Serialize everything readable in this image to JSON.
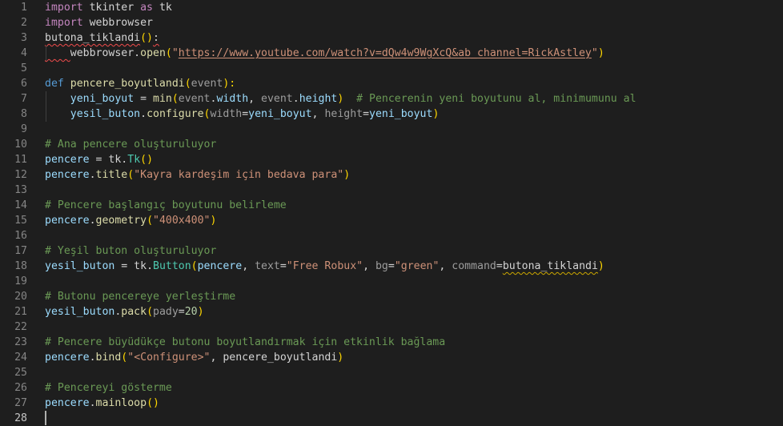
{
  "editor": {
    "language": "python",
    "colors": {
      "background": "#1e1e1e",
      "keyword": "#c586c0",
      "storage": "#569cd6",
      "function": "#dcdcaa",
      "variable": "#9cdcfe",
      "class": "#4ec9b0",
      "string": "#ce9178",
      "number": "#b5cea8",
      "comment": "#6a9955",
      "default": "#d4d4d4",
      "param_dim": "#9d9d9d",
      "bracket_gold": "#ffd700",
      "bracket_violet": "#da70d6",
      "error_squiggle": "#f14c4c",
      "warning_squiggle": "#cca700"
    },
    "lines": [
      {
        "n": "1",
        "tokens": [
          {
            "t": "import",
            "c": "keyword"
          },
          {
            "t": " tkinter ",
            "c": "default"
          },
          {
            "t": "as",
            "c": "keyword"
          },
          {
            "t": " tk",
            "c": "default"
          }
        ]
      },
      {
        "n": "2",
        "tokens": [
          {
            "t": "import",
            "c": "keyword"
          },
          {
            "t": " webbrowser",
            "c": "default"
          }
        ]
      },
      {
        "n": "3",
        "tokens": [
          {
            "t": "butona_tiklandi",
            "c": "default",
            "u": "err"
          },
          {
            "t": "()",
            "c": "bracket_gold"
          },
          {
            "t": ":",
            "c": "default",
            "u": "err"
          }
        ]
      },
      {
        "n": "4",
        "tokens": [
          {
            "t": "    ",
            "c": "default",
            "u": "err"
          },
          {
            "t": "webbrowser",
            "c": "default"
          },
          {
            "t": ".",
            "c": "default"
          },
          {
            "t": "open",
            "c": "function"
          },
          {
            "t": "(",
            "c": "bracket_gold"
          },
          {
            "t": "\"",
            "c": "string"
          },
          {
            "t": "https://www.youtube.com/watch?v=dQw4w9WgXcQ&ab_channel=RickAstley",
            "c": "string",
            "u": "url"
          },
          {
            "t": "\"",
            "c": "string"
          },
          {
            "t": ")",
            "c": "bracket_gold"
          }
        ]
      },
      {
        "n": "5",
        "tokens": []
      },
      {
        "n": "6",
        "tokens": [
          {
            "t": "def",
            "c": "storage"
          },
          {
            "t": " ",
            "c": "default"
          },
          {
            "t": "pencere_boyutlandi",
            "c": "function"
          },
          {
            "t": "(",
            "c": "bracket_gold"
          },
          {
            "t": "event",
            "c": "param_dim"
          },
          {
            "t": "):",
            "c": "bracket_gold"
          }
        ]
      },
      {
        "n": "7",
        "tokens": [
          {
            "t": "    ",
            "c": "default"
          },
          {
            "t": "yeni_boyut",
            "c": "variable"
          },
          {
            "t": " = ",
            "c": "default"
          },
          {
            "t": "min",
            "c": "function"
          },
          {
            "t": "(",
            "c": "bracket_gold"
          },
          {
            "t": "event",
            "c": "param_dim"
          },
          {
            "t": ".",
            "c": "default"
          },
          {
            "t": "width",
            "c": "variable"
          },
          {
            "t": ", ",
            "c": "default"
          },
          {
            "t": "event",
            "c": "param_dim"
          },
          {
            "t": ".",
            "c": "default"
          },
          {
            "t": "height",
            "c": "variable"
          },
          {
            "t": ")",
            "c": "bracket_gold"
          },
          {
            "t": "  ",
            "c": "default"
          },
          {
            "t": "# Pencerenin yeni boyutunu al, minimumunu al",
            "c": "comment"
          }
        ]
      },
      {
        "n": "8",
        "tokens": [
          {
            "t": "    ",
            "c": "default"
          },
          {
            "t": "yesil_buton",
            "c": "variable"
          },
          {
            "t": ".",
            "c": "default"
          },
          {
            "t": "configure",
            "c": "function"
          },
          {
            "t": "(",
            "c": "bracket_gold"
          },
          {
            "t": "width",
            "c": "param_dim"
          },
          {
            "t": "=",
            "c": "default"
          },
          {
            "t": "yeni_boyut",
            "c": "variable"
          },
          {
            "t": ", ",
            "c": "default"
          },
          {
            "t": "height",
            "c": "param_dim"
          },
          {
            "t": "=",
            "c": "default"
          },
          {
            "t": "yeni_boyut",
            "c": "variable"
          },
          {
            "t": ")",
            "c": "bracket_gold"
          }
        ]
      },
      {
        "n": "9",
        "tokens": []
      },
      {
        "n": "10",
        "tokens": [
          {
            "t": "# Ana pencere oluşturuluyor",
            "c": "comment"
          }
        ]
      },
      {
        "n": "11",
        "tokens": [
          {
            "t": "pencere",
            "c": "variable"
          },
          {
            "t": " = ",
            "c": "default"
          },
          {
            "t": "tk",
            "c": "default"
          },
          {
            "t": ".",
            "c": "default"
          },
          {
            "t": "Tk",
            "c": "class"
          },
          {
            "t": "()",
            "c": "bracket_gold"
          }
        ]
      },
      {
        "n": "12",
        "tokens": [
          {
            "t": "pencere",
            "c": "variable"
          },
          {
            "t": ".",
            "c": "default"
          },
          {
            "t": "title",
            "c": "function"
          },
          {
            "t": "(",
            "c": "bracket_gold"
          },
          {
            "t": "\"Kayra kardeşim için bedava para\"",
            "c": "string"
          },
          {
            "t": ")",
            "c": "bracket_gold"
          }
        ]
      },
      {
        "n": "13",
        "tokens": []
      },
      {
        "n": "14",
        "tokens": [
          {
            "t": "# Pencere başlangıç boyutunu belirleme",
            "c": "comment"
          }
        ]
      },
      {
        "n": "15",
        "tokens": [
          {
            "t": "pencere",
            "c": "variable"
          },
          {
            "t": ".",
            "c": "default"
          },
          {
            "t": "geometry",
            "c": "function"
          },
          {
            "t": "(",
            "c": "bracket_gold"
          },
          {
            "t": "\"400x400\"",
            "c": "string"
          },
          {
            "t": ")",
            "c": "bracket_gold"
          }
        ]
      },
      {
        "n": "16",
        "tokens": []
      },
      {
        "n": "17",
        "tokens": [
          {
            "t": "# Yeşil buton oluşturuluyor",
            "c": "comment"
          }
        ]
      },
      {
        "n": "18",
        "tokens": [
          {
            "t": "yesil_buton",
            "c": "variable"
          },
          {
            "t": " = ",
            "c": "default"
          },
          {
            "t": "tk",
            "c": "default"
          },
          {
            "t": ".",
            "c": "default"
          },
          {
            "t": "Button",
            "c": "class"
          },
          {
            "t": "(",
            "c": "bracket_gold"
          },
          {
            "t": "pencere",
            "c": "variable"
          },
          {
            "t": ", ",
            "c": "default"
          },
          {
            "t": "text",
            "c": "param_dim"
          },
          {
            "t": "=",
            "c": "default"
          },
          {
            "t": "\"Free Robux\"",
            "c": "string"
          },
          {
            "t": ", ",
            "c": "default"
          },
          {
            "t": "bg",
            "c": "param_dim"
          },
          {
            "t": "=",
            "c": "default"
          },
          {
            "t": "\"green\"",
            "c": "string"
          },
          {
            "t": ", ",
            "c": "default"
          },
          {
            "t": "command",
            "c": "param_dim"
          },
          {
            "t": "=",
            "c": "default"
          },
          {
            "t": "butona_tiklandi",
            "c": "default",
            "u": "warn"
          },
          {
            "t": ")",
            "c": "bracket_gold"
          }
        ]
      },
      {
        "n": "19",
        "tokens": []
      },
      {
        "n": "20",
        "tokens": [
          {
            "t": "# Butonu pencereye yerleştirme",
            "c": "comment"
          }
        ]
      },
      {
        "n": "21",
        "tokens": [
          {
            "t": "yesil_buton",
            "c": "variable"
          },
          {
            "t": ".",
            "c": "default"
          },
          {
            "t": "pack",
            "c": "function"
          },
          {
            "t": "(",
            "c": "bracket_gold"
          },
          {
            "t": "pady",
            "c": "param_dim"
          },
          {
            "t": "=",
            "c": "default"
          },
          {
            "t": "20",
            "c": "number"
          },
          {
            "t": ")",
            "c": "bracket_gold"
          }
        ]
      },
      {
        "n": "22",
        "tokens": []
      },
      {
        "n": "23",
        "tokens": [
          {
            "t": "# Pencere büyüdükçe butonu boyutlandırmak için etkinlik bağlama",
            "c": "comment"
          }
        ]
      },
      {
        "n": "24",
        "tokens": [
          {
            "t": "pencere",
            "c": "variable"
          },
          {
            "t": ".",
            "c": "default"
          },
          {
            "t": "bind",
            "c": "function"
          },
          {
            "t": "(",
            "c": "bracket_gold"
          },
          {
            "t": "\"<Configure>\"",
            "c": "string"
          },
          {
            "t": ", ",
            "c": "default"
          },
          {
            "t": "pencere_boyutlandi",
            "c": "default"
          },
          {
            "t": ")",
            "c": "bracket_gold"
          }
        ]
      },
      {
        "n": "25",
        "tokens": []
      },
      {
        "n": "26",
        "tokens": [
          {
            "t": "# Pencereyi gösterme",
            "c": "comment"
          }
        ]
      },
      {
        "n": "27",
        "tokens": [
          {
            "t": "pencere",
            "c": "variable"
          },
          {
            "t": ".",
            "c": "default"
          },
          {
            "t": "mainloop",
            "c": "function"
          },
          {
            "t": "()",
            "c": "bracket_gold"
          }
        ]
      },
      {
        "n": "28",
        "tokens": []
      }
    ]
  }
}
